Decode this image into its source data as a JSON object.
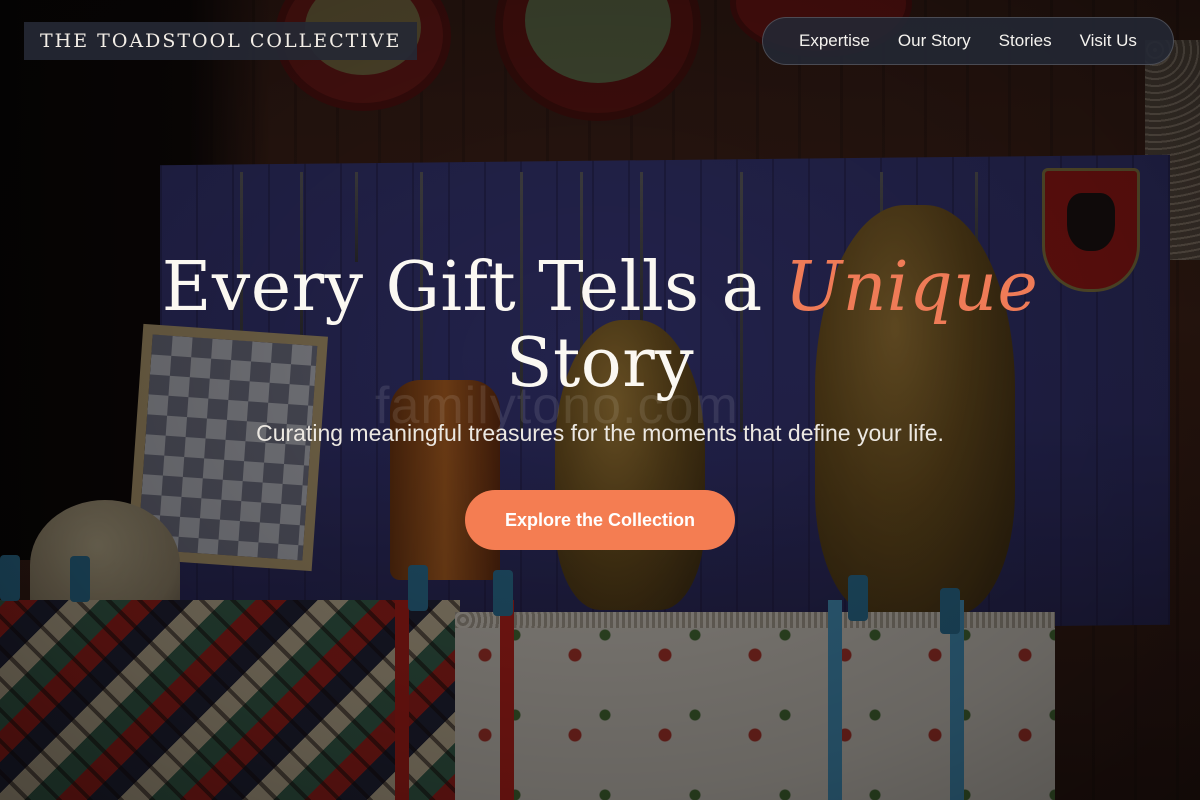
{
  "brand": {
    "name": "THE TOADSTOOL COLLECTIVE"
  },
  "nav": {
    "items": [
      {
        "label": "Expertise"
      },
      {
        "label": "Our Story"
      },
      {
        "label": "Stories"
      },
      {
        "label": "Visit Us"
      }
    ]
  },
  "hero": {
    "title_main": "Every Gift Tells a",
    "title_accent": "Unique",
    "title_end": "Story",
    "subtitle": "Curating meaningful treasures for the moments that define your life.",
    "cta_label": "Explore the Collection",
    "watermark": "familytono.com"
  },
  "colors": {
    "accent": "#f47d52",
    "title_accent": "#ef7b57",
    "nav_bg": "#232834",
    "brand_bg": "#252834"
  }
}
